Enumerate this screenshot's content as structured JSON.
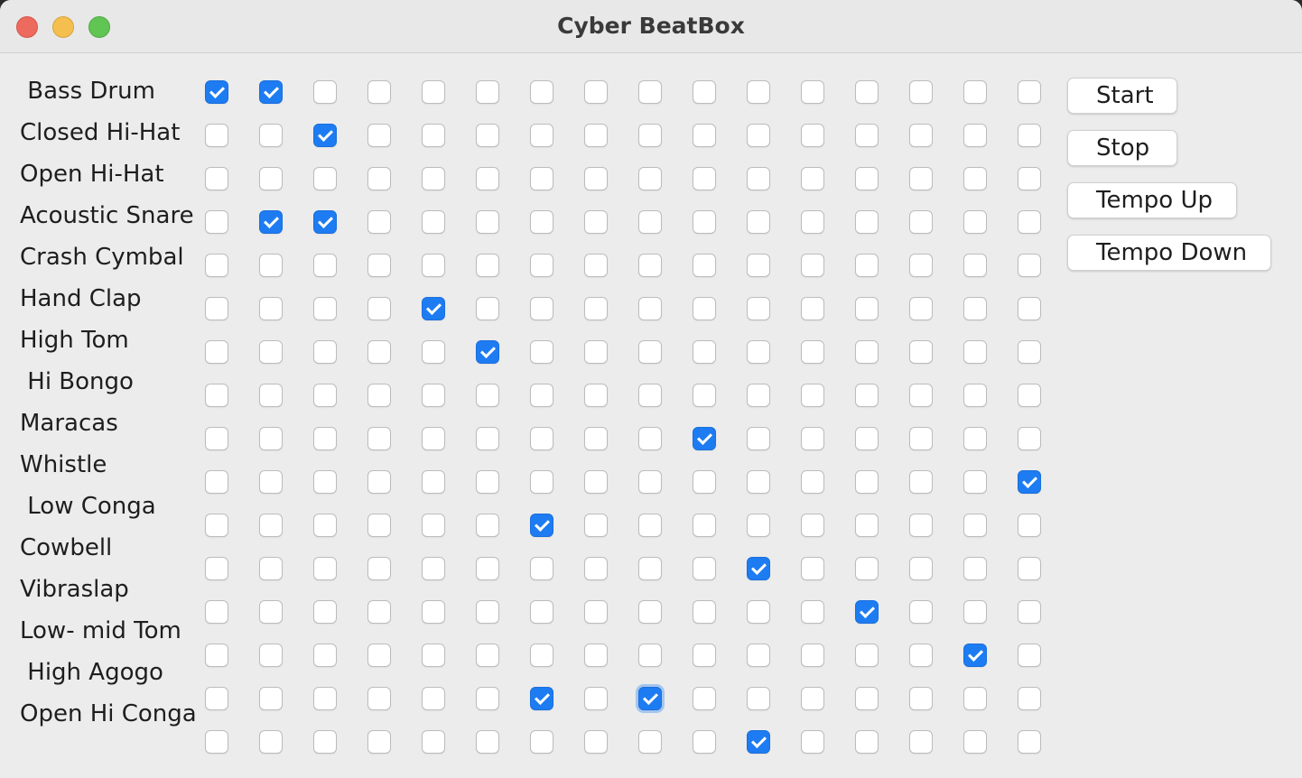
{
  "window": {
    "title": "Cyber BeatBox"
  },
  "instruments": [
    " Bass Drum",
    "Closed Hi-Hat",
    "Open Hi-Hat",
    "Acoustic Snare",
    "Crash Cymbal",
    "Hand Clap",
    "High Tom",
    " Hi Bongo",
    "Maracas",
    "Whistle",
    " Low Conga",
    "Cowbell",
    "Vibraslap",
    "Low- mid Tom",
    " High Agogo",
    "Open Hi Conga"
  ],
  "grid": {
    "rows": 16,
    "cols": 16,
    "checked": [
      [
        0,
        0
      ],
      [
        0,
        1
      ],
      [
        1,
        2
      ],
      [
        3,
        1
      ],
      [
        3,
        2
      ],
      [
        5,
        4
      ],
      [
        6,
        5
      ],
      [
        8,
        9
      ],
      [
        9,
        15
      ],
      [
        10,
        6
      ],
      [
        11,
        10
      ],
      [
        12,
        12
      ],
      [
        13,
        14
      ],
      [
        14,
        6
      ],
      [
        14,
        8
      ],
      [
        15,
        10
      ]
    ],
    "focused": [
      14,
      8
    ]
  },
  "buttons": {
    "start": "Start",
    "stop": "Stop",
    "tempo_up": "Tempo Up",
    "tempo_down": "Tempo Down"
  }
}
